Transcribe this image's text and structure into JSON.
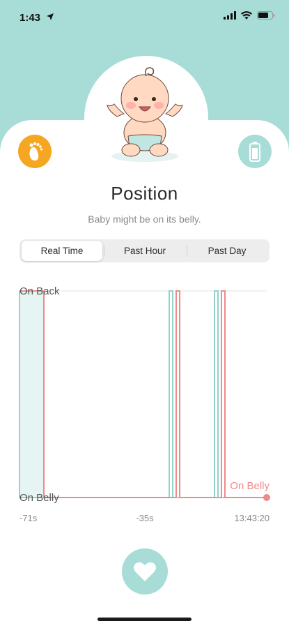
{
  "status_bar": {
    "time": "1:43"
  },
  "screen": {
    "title": "Position",
    "subtitle": "Baby might be on its belly."
  },
  "tabs": [
    {
      "label": "Real Time",
      "active": true
    },
    {
      "label": "Past Hour",
      "active": false
    },
    {
      "label": "Past Day",
      "active": false
    }
  ],
  "colors": {
    "teal": "#a8dcd6",
    "teal_line": "#8fd3cb",
    "red_line": "#f08a8a",
    "orange": "#f5a623"
  },
  "icons": {
    "left": "footprint-icon",
    "right": "battery-icon",
    "bottom": "heart-icon"
  },
  "chart_data": {
    "type": "line",
    "y_categories": [
      "On Belly",
      "On Back"
    ],
    "x_ticks": [
      "-71s",
      "-35s",
      "13:43:20"
    ],
    "current_label": "On Belly",
    "x_range": [
      -71,
      0
    ],
    "series": [
      {
        "color": "#8fd3cb",
        "points": [
          [
            -71,
            1
          ],
          [
            -71,
            0
          ],
          [
            -28,
            0
          ],
          [
            -28,
            1
          ],
          [
            -27,
            1
          ],
          [
            -27,
            0
          ],
          [
            -15,
            0
          ],
          [
            -15,
            1
          ],
          [
            -14,
            1
          ],
          [
            -14,
            0
          ],
          [
            0,
            0
          ]
        ]
      },
      {
        "color": "#f08a8a",
        "points": [
          [
            -71,
            1
          ],
          [
            -64,
            1
          ],
          [
            -64,
            0
          ],
          [
            -26,
            0
          ],
          [
            -26,
            1
          ],
          [
            -25,
            1
          ],
          [
            -25,
            0
          ],
          [
            -13,
            0
          ],
          [
            -13,
            1
          ],
          [
            -12,
            1
          ],
          [
            -12,
            0
          ],
          [
            0,
            0
          ]
        ]
      }
    ],
    "shaded_region": [
      -71,
      -64
    ]
  }
}
